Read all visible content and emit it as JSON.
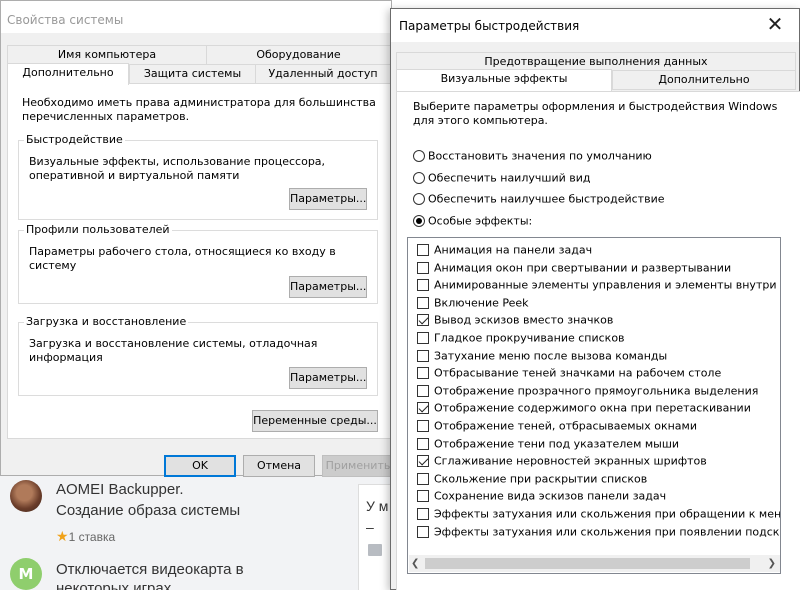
{
  "background_page": {
    "items": [
      {
        "avatar_letter": "",
        "line1": "AOMEI Backupper.",
        "line2": "Создание образа системы",
        "rating": "1 ставка"
      },
      {
        "avatar_letter": "M",
        "line1": "Отключается видеокарта в",
        "line2": "некоторых играх"
      }
    ],
    "right_panel": {
      "text": "У м",
      "dash": "–"
    }
  },
  "system_properties": {
    "title": "Свойства системы",
    "tabs_top": [
      "Имя компьютера",
      "Оборудование"
    ],
    "tabs_bottom": [
      "Дополнительно",
      "Защита системы",
      "Удаленный доступ"
    ],
    "active_tab": "Дополнительно",
    "admin_note": "Необходимо иметь права администратора для большинства перечисленных параметров.",
    "groups": [
      {
        "title": "Быстродействие",
        "description": "Визуальные эффекты, использование процессора, оперативной и виртуальной памяти",
        "button": "Параметры..."
      },
      {
        "title": "Профили пользователей",
        "description": "Параметры рабочего стола, относящиеся ко входу в систему",
        "button": "Параметры..."
      },
      {
        "title": "Загрузка и восстановление",
        "description": "Загрузка и восстановление системы, отладочная информация",
        "button": "Параметры..."
      }
    ],
    "env_button": "Переменные среды...",
    "ok_button": "OK",
    "cancel_button": "Отмена",
    "apply_button": "Применить"
  },
  "performance_options": {
    "title": "Параметры быстродействия",
    "tab_top": "Предотвращение выполнения данных",
    "tabs_bottom": [
      "Визуальные эффекты",
      "Дополнительно"
    ],
    "active_tab": "Визуальные эффекты",
    "instruction": "Выберите параметры оформления и быстродействия Windows для этого компьютера.",
    "radios": [
      {
        "label": "Восстановить значения по умолчанию",
        "selected": false
      },
      {
        "label": "Обеспечить наилучший вид",
        "selected": false
      },
      {
        "label": "Обеспечить наилучшее быстродействие",
        "selected": false
      },
      {
        "label": "Особые эффекты:",
        "selected": true
      }
    ],
    "effects": [
      {
        "label": "Анимация на панели задач",
        "checked": false
      },
      {
        "label": "Анимация окон при свертывании и развертывании",
        "checked": false
      },
      {
        "label": "Анимированные элементы управления и элементы внутри окн",
        "checked": false
      },
      {
        "label": "Включение Peek",
        "checked": false
      },
      {
        "label": "Вывод эскизов вместо значков",
        "checked": true
      },
      {
        "label": "Гладкое прокручивание списков",
        "checked": false
      },
      {
        "label": "Затухание меню после вызова команды",
        "checked": false
      },
      {
        "label": "Отбрасывание теней значками на рабочем столе",
        "checked": false
      },
      {
        "label": "Отображение прозрачного прямоугольника выделения",
        "checked": false
      },
      {
        "label": "Отображение содержимого окна при перетаскивании",
        "checked": true
      },
      {
        "label": "Отображение теней, отбрасываемых окнами",
        "checked": false
      },
      {
        "label": "Отображение тени под указателем мыши",
        "checked": false
      },
      {
        "label": "Сглаживание неровностей экранных шрифтов",
        "checked": true
      },
      {
        "label": "Скольжение при раскрытии списков",
        "checked": false
      },
      {
        "label": "Сохранение вида эскизов панели задач",
        "checked": false
      },
      {
        "label": "Эффекты затухания или скольжения при обращении к меню",
        "checked": false
      },
      {
        "label": "Эффекты затухания или скольжения при появлении подсказок",
        "checked": false
      }
    ],
    "close_icon": "close-icon"
  }
}
